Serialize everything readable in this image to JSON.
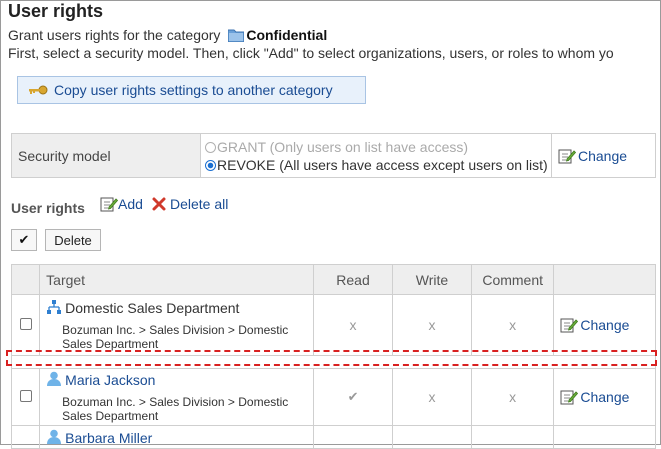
{
  "page": {
    "title": "User rights",
    "grant_prefix": "Grant users rights for the category",
    "category": "Confidential",
    "instructions": "First, select a security model. Then, click \"Add\" to select organizations, users, or roles to whom yo"
  },
  "copy_button": {
    "label": "Copy user rights settings to another category"
  },
  "security": {
    "label": "Security model",
    "grant_option": "GRANT (Only users on list have access)",
    "revoke_option": "REVOKE (All users have access except users on list)",
    "selected": "REVOKE",
    "change": "Change"
  },
  "user_rights": {
    "heading": "User rights",
    "add": "Add",
    "delete_all": "Delete all",
    "check_all": "✔",
    "delete_button": "Delete"
  },
  "table": {
    "headers": [
      "Target",
      "Read",
      "Write",
      "Comment"
    ],
    "rows": [
      {
        "name": "Domestic Sales Department",
        "type": "organization-icon",
        "path": "Bozuman Inc. > Sales Division > Domestic Sales Department",
        "read": "x",
        "write": "x",
        "comment": "x",
        "change": "Change"
      },
      {
        "name": "Maria Jackson",
        "type": "user-icon",
        "path": "Bozuman Inc. > Sales Division > Domestic Sales Department",
        "read": "✔",
        "write": "x",
        "comment": "x",
        "change": "Change"
      },
      {
        "name": "Barbara Miller",
        "type": "user-icon"
      }
    ]
  },
  "colors": {
    "link": "#1a4c93",
    "highlight_dash": "#d92020",
    "header_bg": "#eeeeee"
  }
}
